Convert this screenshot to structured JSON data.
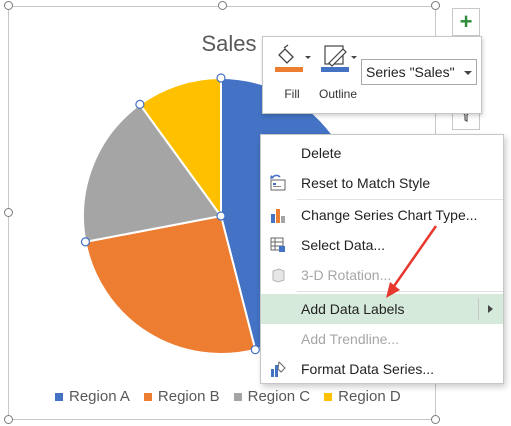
{
  "chart": {
    "title": "Sales",
    "legend": [
      {
        "label": "Region A",
        "color": "#4472c4"
      },
      {
        "label": "Region B",
        "color": "#ed7d31"
      },
      {
        "label": "Region C",
        "color": "#a5a5a5"
      },
      {
        "label": "Region D",
        "color": "#ffc000"
      }
    ]
  },
  "chart_data": {
    "type": "pie",
    "title": "Sales",
    "categories": [
      "Region A",
      "Region B",
      "Region C",
      "Region D"
    ],
    "values": [
      46,
      26,
      18,
      10
    ],
    "colors": [
      "#4472c4",
      "#ed7d31",
      "#a5a5a5",
      "#ffc000"
    ],
    "legend_position": "bottom"
  },
  "mini_toolbar": {
    "fill_label": "Fill",
    "outline_label": "Outline",
    "series_select_value": "Series \"Sales\""
  },
  "context_menu": {
    "items": [
      {
        "label": "Delete",
        "icon": "none",
        "enabled": true
      },
      {
        "label": "Reset to Match Style",
        "icon": "reset-style-icon",
        "enabled": true
      },
      {
        "label": "Change Series Chart Type...",
        "icon": "bar-chart-icon",
        "enabled": true
      },
      {
        "label": "Select Data...",
        "icon": "table-data-icon",
        "enabled": true
      },
      {
        "label": "3-D Rotation...",
        "icon": "cube-icon",
        "enabled": false
      },
      {
        "label": "Add Data Labels",
        "icon": "none",
        "enabled": true,
        "submenu": true,
        "highlighted": true
      },
      {
        "label": "Add Trendline...",
        "icon": "none",
        "enabled": false
      },
      {
        "label": "Format Data Series...",
        "icon": "format-series-icon",
        "enabled": true
      }
    ]
  },
  "side_buttons": [
    "plus-icon",
    "brush-icon",
    "filter-icon"
  ],
  "annotation_arrow_color": "#e8372d"
}
